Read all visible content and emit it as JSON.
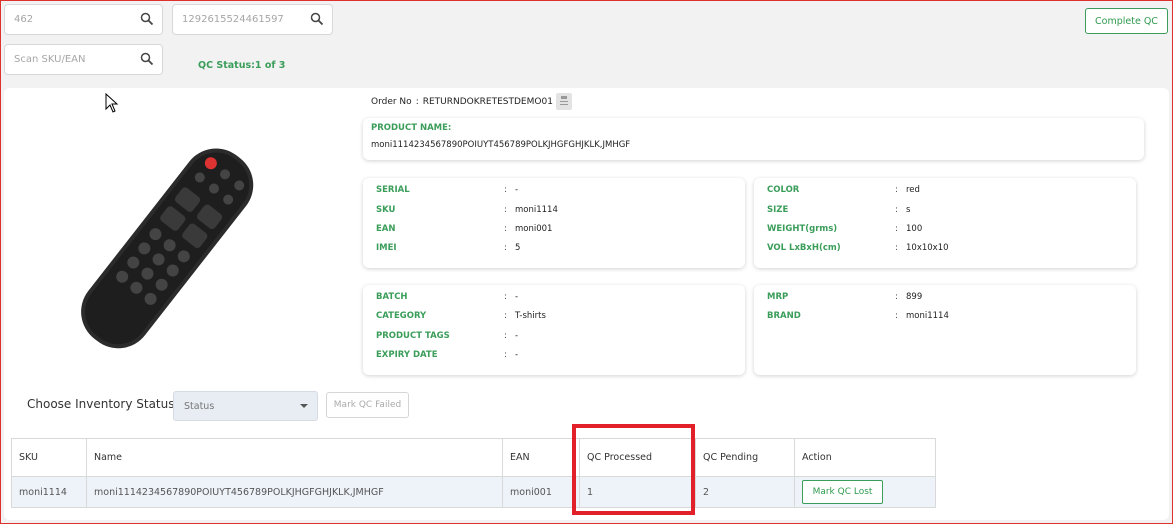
{
  "search": {
    "box1_value": "462",
    "box2_value": "1292615524461597",
    "scan_placeholder": "Scan SKU/EAN"
  },
  "complete_qc_label": "Complete QC",
  "qc_status": "QC Status:1 of 3",
  "order": {
    "label": "Order No",
    "sep": ":",
    "value": "RETURNDOKRETESTDEMO01"
  },
  "product": {
    "name_label": "PRODUCT NAME:",
    "name_value": "moni1114234567890POIUYT456789POLKJHGFGHJKLK,JMHGF"
  },
  "details_left_1": [
    {
      "key": "SERIAL",
      "value": "-"
    },
    {
      "key": "SKU",
      "value": "moni1114"
    },
    {
      "key": "EAN",
      "value": "moni001"
    },
    {
      "key": "IMEI",
      "value": "5"
    }
  ],
  "details_right_1": [
    {
      "key": "COLOR",
      "value": "red"
    },
    {
      "key": "SIZE",
      "value": "s"
    },
    {
      "key": "WEIGHT(grms)",
      "value": "100"
    },
    {
      "key": "VOL LxBxH(cm)",
      "value": "10x10x10"
    }
  ],
  "details_left_2": [
    {
      "key": "BATCH",
      "value": "-"
    },
    {
      "key": "CATEGORY",
      "value": "T-shirts"
    },
    {
      "key": "PRODUCT TAGS",
      "value": "-"
    },
    {
      "key": "EXPIRY DATE",
      "value": "-"
    }
  ],
  "details_right_2": [
    {
      "key": "MRP",
      "value": "899"
    },
    {
      "key": "BRAND",
      "value": "moni1114"
    }
  ],
  "colon": ":",
  "inventory": {
    "label": "Choose Inventory Status",
    "select_value": "Status",
    "mark_failed_label": "Mark QC Failed"
  },
  "table": {
    "headers": [
      "SKU",
      "Name",
      "EAN",
      "QC Processed",
      "QC Pending",
      "Action"
    ],
    "row": {
      "sku": "moni1114",
      "name": "moni1114234567890POIUYT456789POLKJHGFGHJKLK,JMHGF",
      "ean": "moni001",
      "qc_processed": "1",
      "qc_pending": "2",
      "action_label": "Mark QC Lost"
    }
  },
  "colors": {
    "accent_green": "#3a9d5a",
    "highlight_red": "#e2202a",
    "frame_red": "#e0302b"
  },
  "icons": {
    "search": "search-icon",
    "copy": "copy-icon",
    "dropdown": "caret-down-icon",
    "cursor": "mouse-pointer-icon"
  }
}
